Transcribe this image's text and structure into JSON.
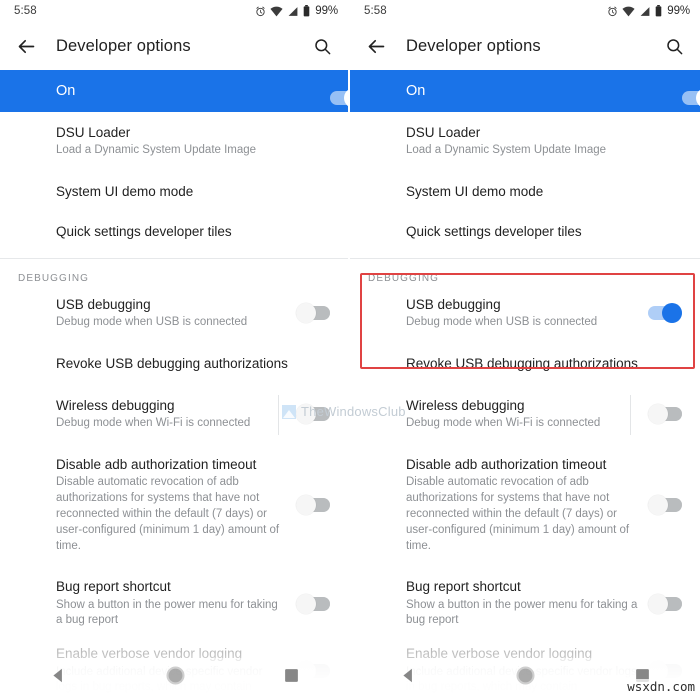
{
  "meta": {
    "accent_blue": "#1a73e8",
    "highlight_red": "#e04343",
    "watermark_center": "TheWindowsClub",
    "watermark_corner": "wsxdn.com"
  },
  "status_bar": {
    "time": "5:58",
    "battery_percent": "99%",
    "icons": [
      "alarm-icon",
      "wifi-icon",
      "signal-icon",
      "battery-icon"
    ]
  },
  "app_bar": {
    "back_icon": "arrow-back-icon",
    "title": "Developer options",
    "search_icon": "search-icon"
  },
  "master_switch": {
    "label": "On",
    "state": "on"
  },
  "left": {
    "rows": [
      {
        "title": "DSU Loader",
        "subtitle": "Load a Dynamic System Update Image",
        "control": "none"
      },
      {
        "title": "System UI demo mode",
        "subtitle": "",
        "control": "none"
      },
      {
        "title": "Quick settings developer tiles",
        "subtitle": "",
        "control": "none"
      }
    ],
    "section_label": "DEBUGGING",
    "debug_rows": [
      {
        "title": "USB debugging",
        "subtitle": "Debug mode when USB is connected",
        "control": "switch",
        "state": "off",
        "rule": false
      },
      {
        "title": "Revoke USB debugging authorizations",
        "subtitle": "",
        "control": "none",
        "rule": false
      },
      {
        "title": "Wireless debugging",
        "subtitle": "Debug mode when Wi-Fi is connected",
        "control": "switch",
        "state": "off",
        "rule": true
      },
      {
        "title": "Disable adb authorization timeout",
        "subtitle": "Disable automatic revocation of adb authorizations for systems that have not reconnected within the default (7 days) or user-configured (minimum 1 day) amount of time.",
        "control": "switch",
        "state": "off",
        "rule": false
      },
      {
        "title": "Bug report shortcut",
        "subtitle": "Show a button in the power menu for taking a bug report",
        "control": "switch",
        "state": "off",
        "rule": false
      }
    ],
    "cut_off_row": {
      "title": "Enable verbose vendor logging",
      "subtitle": "Include additional device-specific vendor logs in bug reports, which may contain"
    }
  },
  "right": {
    "rows": [
      {
        "title": "DSU Loader",
        "subtitle": "Load a Dynamic System Update Image",
        "control": "none"
      },
      {
        "title": "System UI demo mode",
        "subtitle": "",
        "control": "none"
      },
      {
        "title": "Quick settings developer tiles",
        "subtitle": "",
        "control": "none"
      }
    ],
    "section_label": "DEBUGGING",
    "debug_rows": [
      {
        "title": "USB debugging",
        "subtitle": "Debug mode when USB is connected",
        "control": "switch",
        "state": "on",
        "rule": false
      },
      {
        "title": "Revoke USB debugging authorizations",
        "subtitle": "",
        "control": "none",
        "rule": false
      },
      {
        "title": "Wireless debugging",
        "subtitle": "Debug mode when Wi-Fi is connected",
        "control": "switch",
        "state": "off",
        "rule": true
      },
      {
        "title": "Disable adb authorization timeout",
        "subtitle": "Disable automatic revocation of adb authorizations for systems that have not reconnected within the default (7 days) or user-configured (minimum 1 day) amount of time.",
        "control": "switch",
        "state": "off",
        "rule": false
      },
      {
        "title": "Bug report shortcut",
        "subtitle": "Show a button in the power menu for taking a bug report",
        "control": "switch",
        "state": "off",
        "rule": false
      }
    ],
    "cut_off_row": {
      "title": "Enable verbose vendor logging",
      "subtitle": "Include additional device-specific vendor logs in bug reports, which may contain"
    }
  },
  "nav_bar": {
    "back_icon": "nav-back-triangle-icon",
    "home_icon": "nav-home-circle-icon",
    "recents_icon": "nav-recents-square-icon"
  }
}
